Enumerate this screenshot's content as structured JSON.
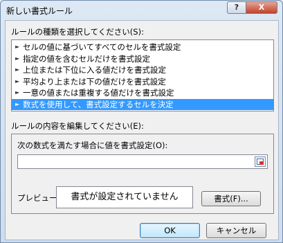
{
  "window": {
    "title": "新しい書式ルール",
    "help_label": "?",
    "close_label": "X"
  },
  "rule_type": {
    "label": "ルールの種類を選択してください(S):",
    "items": [
      {
        "label": "セルの値に基づいてすべてのセルを書式設定",
        "selected": false
      },
      {
        "label": "指定の値を含むセルだけを書式設定",
        "selected": false
      },
      {
        "label": "上位または下位に入る値だけを書式設定",
        "selected": false
      },
      {
        "label": "平均より上または下の値だけを書式設定",
        "selected": false
      },
      {
        "label": "一意の値または重複する値だけを書式設定",
        "selected": false
      },
      {
        "label": "数式を使用して、書式設定するセルを決定",
        "selected": true
      }
    ]
  },
  "rule_edit": {
    "label": "ルールの内容を編集してください(E):",
    "formula_label": "次の数式を満たす場合に値を書式設定(O):",
    "formula_value": "",
    "preview_label": "プレビュー:",
    "preview_text": "書式が設定されていません",
    "format_button": "書式(F)..."
  },
  "buttons": {
    "ok": "OK",
    "cancel": "キャンセル"
  },
  "colors": {
    "selection": "#3399ff",
    "title_bar": "#dde8f4",
    "close_button": "#c0432b"
  }
}
